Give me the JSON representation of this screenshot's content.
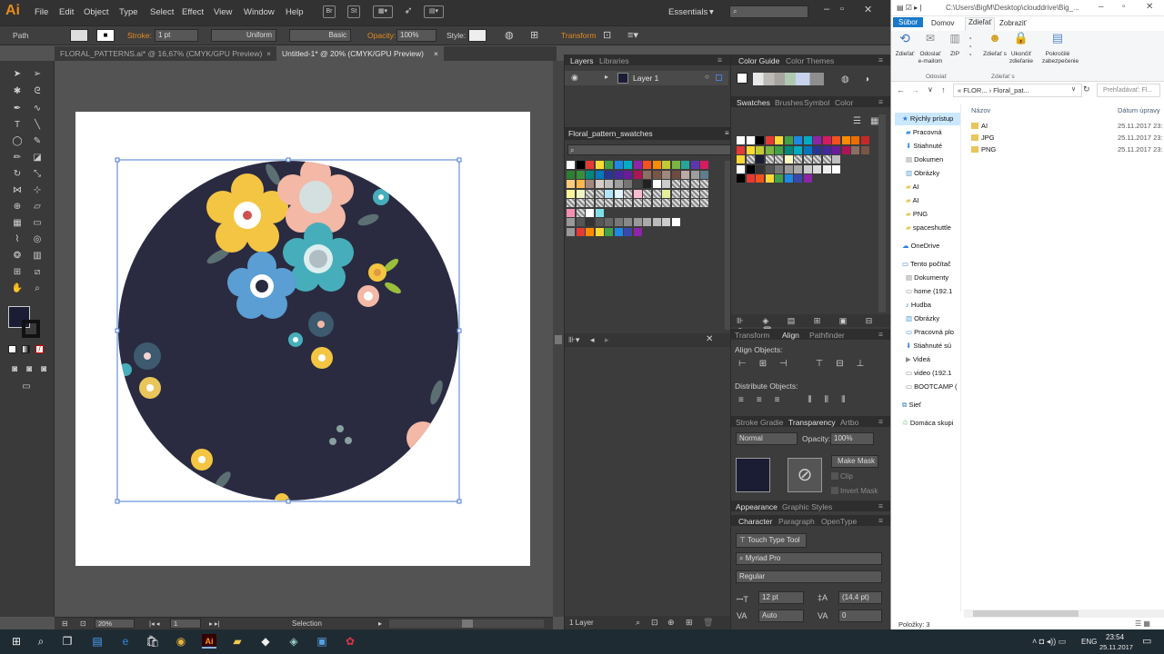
{
  "menubar": {
    "logo": "Ai",
    "items": [
      "File",
      "Edit",
      "Object",
      "Type",
      "Select",
      "Effect",
      "View",
      "Window",
      "Help"
    ],
    "bridge": "Br",
    "stock": "St",
    "workspace": "Essentials"
  },
  "control": {
    "selection_type": "Path",
    "stroke_label": "Stroke:",
    "stroke_value": "1 pt",
    "profile": "Uniform",
    "brush": "Basic",
    "opacity_label": "Opacity:",
    "opacity_value": "100%",
    "style_label": "Style:",
    "transform": "Transform"
  },
  "tabs": [
    {
      "label": "FLORAL_PATTERNS.ai* @ 16,67% (CMYK/GPU Preview)"
    },
    {
      "label": "Untitled-1* @ 20% (CMYK/GPU Preview)"
    }
  ],
  "status": {
    "zoom": "20%",
    "artboard": "1",
    "tool": "Selection"
  },
  "layers_panel": {
    "tab_layers": "Layers",
    "tab_libraries": "Libraries",
    "layer_name": "Layer 1",
    "footer": "1 Layer"
  },
  "swatch_library": {
    "title": "Floral_pattern_swatches"
  },
  "color_guide": {
    "tab": "Color Guide",
    "tab2": "Color Themes"
  },
  "swatches_panel": {
    "tabs": [
      "Swatches",
      "Brushes",
      "Symbol",
      "Color"
    ]
  },
  "align_panel": {
    "tabs": [
      "Transform",
      "Align",
      "Pathfinder"
    ],
    "align_objects": "Align Objects:",
    "distribute_objects": "Distribute Objects:"
  },
  "transparency_panel": {
    "tabs": [
      "Stroke",
      "Gradie",
      "Transparency",
      "Artbo"
    ],
    "blend_mode": "Normal",
    "opacity_label": "Opacity:",
    "opacity_value": "100%",
    "make_mask": "Make Mask",
    "clip": "Clip",
    "invert_mask": "Invert Mask"
  },
  "appearance_panel": {
    "tabs": [
      "Appearance",
      "Graphic Styles"
    ]
  },
  "character_panel": {
    "tabs": [
      "Character",
      "Paragraph",
      "OpenType"
    ],
    "touch_type": "Touch Type Tool",
    "font_family": "Myriad Pro",
    "font_style": "Regular",
    "font_size": "12 pt",
    "leading": "(14,4 pt)",
    "kerning": "Auto",
    "tracking": "0"
  },
  "explorer": {
    "path": "C:\\Users\\BigM\\Desktop\\clouddrive\\Big_...",
    "ribbon_tabs": [
      "Súbor",
      "Domov",
      "Zdieľať",
      "Zobraziť"
    ],
    "ribbon_buttons": [
      "Zdieľať",
      "Odoslať e-mailom",
      "ZIP",
      "Zdieľať s",
      "Ukončiť zdieľanie",
      "Pokročilé zabezpečenie"
    ],
    "groups": [
      "Odoslať",
      "Zdieľať s"
    ],
    "breadcrumb": "« FLOR... › Floral_pat...",
    "search_placeholder": "Prehľadávať: Fl...",
    "col_name": "Názov",
    "col_date": "Dátum úpravy",
    "nav": [
      "Rýchly prístup",
      "Pracovná",
      "Stiahnuté",
      "Dokumen",
      "Obrázky",
      "AI",
      "AI",
      "PNG",
      "spaceshuttle",
      "OneDrive",
      "Tento počítač",
      "Dokumenty",
      "home (192.1",
      "Hudba",
      "Obrázky",
      "Pracovná plo",
      "Stiahnuté sú",
      "Videá",
      "video (192.1",
      "BOOTCAMP (",
      "Sieť",
      "Domáca skupi"
    ],
    "files": [
      {
        "name": "AI",
        "date": "25.11.2017 23:"
      },
      {
        "name": "JPG",
        "date": "25.11.2017 23:"
      },
      {
        "name": "PNG",
        "date": "25.11.2017 23:"
      }
    ],
    "status": "Položky: 3"
  },
  "taskbar": {
    "lang": "ENG",
    "time": "23:54",
    "date": "25.11.2017"
  }
}
